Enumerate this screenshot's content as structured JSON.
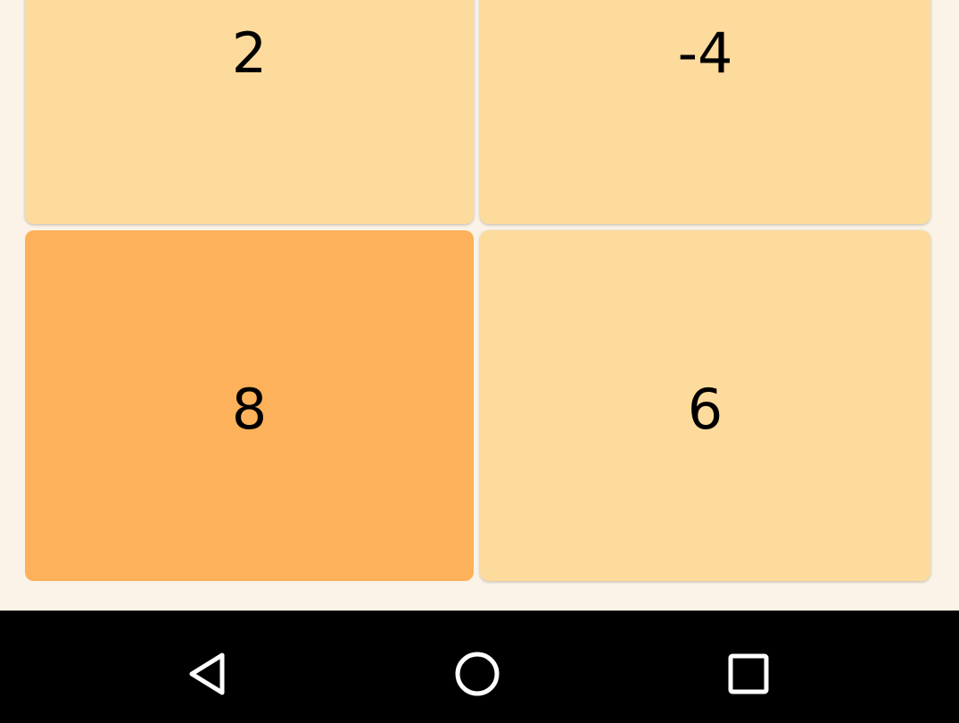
{
  "grid": {
    "tiles": [
      {
        "value": "2",
        "color": "#FDDB9C",
        "selected": false
      },
      {
        "value": "-4",
        "color": "#FDDB9C",
        "selected": false
      },
      {
        "value": "8",
        "color": "#FDB15B",
        "selected": true
      },
      {
        "value": "6",
        "color": "#FDDB9C",
        "selected": false
      }
    ]
  },
  "theme": {
    "background": "#FBF3E8",
    "tile": "#FDDB9C",
    "tile_selected": "#FDB15B",
    "navbar": "#000000",
    "nav_icon": "#FFFFFF"
  },
  "navbar": {
    "buttons": [
      {
        "icon": "back-triangle-icon"
      },
      {
        "icon": "home-circle-icon"
      },
      {
        "icon": "recent-apps-square-icon"
      }
    ]
  }
}
